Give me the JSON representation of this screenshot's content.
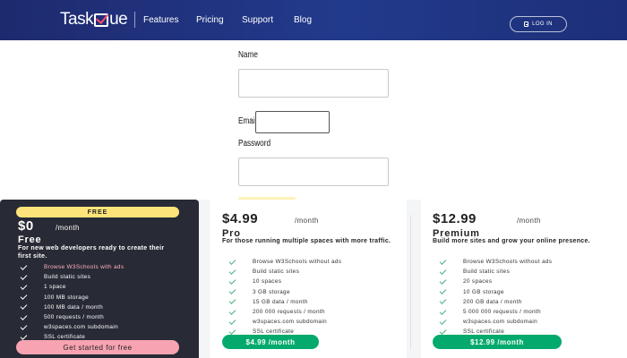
{
  "header": {
    "logo_prefix": "Task",
    "logo_suffix": "ue",
    "nav": [
      "Features",
      "Pricing",
      "Support",
      "Blog"
    ],
    "login_label": "LOG IN"
  },
  "form": {
    "name_label": "Name",
    "email_label": "Email",
    "password_label": "Password",
    "name_value": "",
    "email_value": "",
    "password_value": ""
  },
  "plans": {
    "free": {
      "badge": "FREE",
      "price": "$0",
      "per": "/month",
      "name": "Free",
      "desc": "For new web developers ready to create their first site.",
      "features": [
        "Browse W3Schools with ads",
        "Build static sites",
        "1 space",
        "100 MB storage",
        "100 MB data / month",
        "500 requests / month",
        "w3spaces.com subdomain",
        "SSL certificate"
      ],
      "cta": "Get started for free"
    },
    "pro": {
      "price": "$4.99",
      "per": "/month",
      "name": "Pro",
      "desc": "For those running multiple spaces with more traffic.",
      "features": [
        "Browse W3Schools without ads",
        "Build static sites",
        "10 spaces",
        "3 GB storage",
        "15 GB data / month",
        "200 000 requests / month",
        "w3spaces.com subdomain",
        "SSL certificate"
      ],
      "cta": "$4.99 /month"
    },
    "premium": {
      "price": "$12.99",
      "per": "/month",
      "name": "Premium",
      "desc": "Build more sites and grow your online presence.",
      "features": [
        "Browse W3Schools without ads",
        "Build static sites",
        "20 spaces",
        "10 GB storage",
        "200 GB data / month",
        "5 000 000 requests / month",
        "w3spaces.com subdomain",
        "SSL certificate"
      ],
      "cta": "$12.99 /month"
    }
  },
  "colors": {
    "header_bg": "#1e2a6e",
    "free_card_bg": "#282a35",
    "free_badge": "#fde47a",
    "free_cta": "#f7a3b2",
    "green": "#04aa6d",
    "check_green": "#4caf7d"
  }
}
